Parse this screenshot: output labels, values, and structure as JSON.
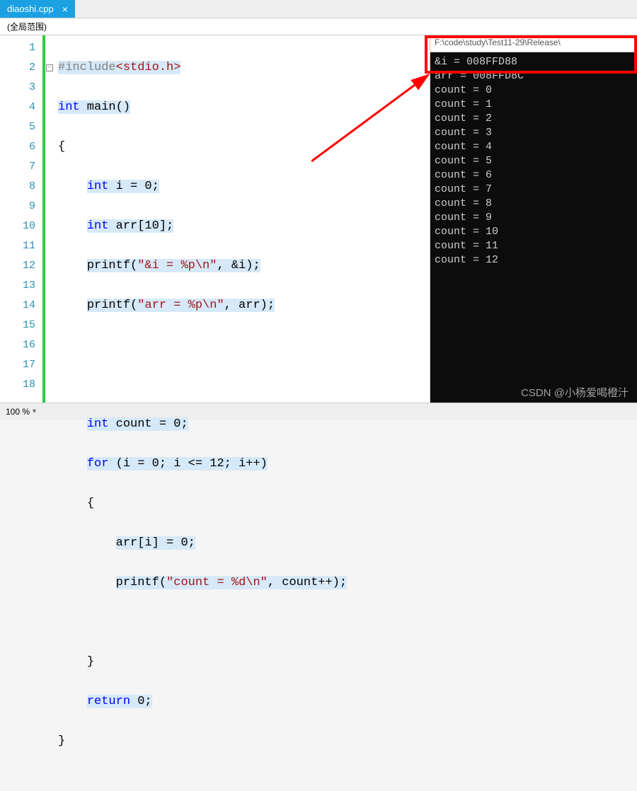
{
  "tab": {
    "name": "diaoshi.cpp",
    "close": "×"
  },
  "scope": "(全局范围)",
  "zoom": "100 %",
  "gutter": [
    "1",
    "2",
    "3",
    "4",
    "5",
    "6",
    "7",
    "8",
    "9",
    "10",
    "11",
    "12",
    "13",
    "14",
    "15",
    "16",
    "17",
    "18"
  ],
  "code": {
    "l1_pp": "#include",
    "l1_inc": "<stdio.h>",
    "l2_kw": "int",
    "l2_rest": " main()",
    "l3": "{",
    "l4_kw": "int",
    "l4_rest": " i = 0;",
    "l5_kw": "int",
    "l5_rest": " arr[10];",
    "l6_fn": "printf",
    "l6_s": "\"&i = %p\\n\"",
    "l6_rest": ", &i);",
    "l7_fn": "printf",
    "l7_s": "\"arr = %p\\n\"",
    "l7_rest": ", arr);",
    "l8": "",
    "l9": "",
    "l10_kw": "int",
    "l10_rest": " count = 0;",
    "l11_kw": "for",
    "l11_rest": " (i = 0; i <= 12; i++)",
    "l12": "{",
    "l13": "arr[i] = 0;",
    "l14_fn": "printf",
    "l14_s": "\"count = %d\\n\"",
    "l14_rest": ", count++);",
    "l15": "",
    "l16": "}",
    "l17_kw": "return",
    "l17_rest": " 0;",
    "l18": "}"
  },
  "console": {
    "title": "F:\\code\\study\\Test11-29\\Release\\",
    "lines": [
      "&i = 008FFD88",
      "arr = 008FFD8C",
      "count = 0",
      "count = 1",
      "count = 2",
      "count = 3",
      "count = 4",
      "count = 5",
      "count = 6",
      "count = 7",
      "count = 8",
      "count = 9",
      "count = 10",
      "count = 11",
      "count = 12"
    ]
  },
  "watermark": "CSDN @小杨爱喝橙汁",
  "fold_minus": "−"
}
